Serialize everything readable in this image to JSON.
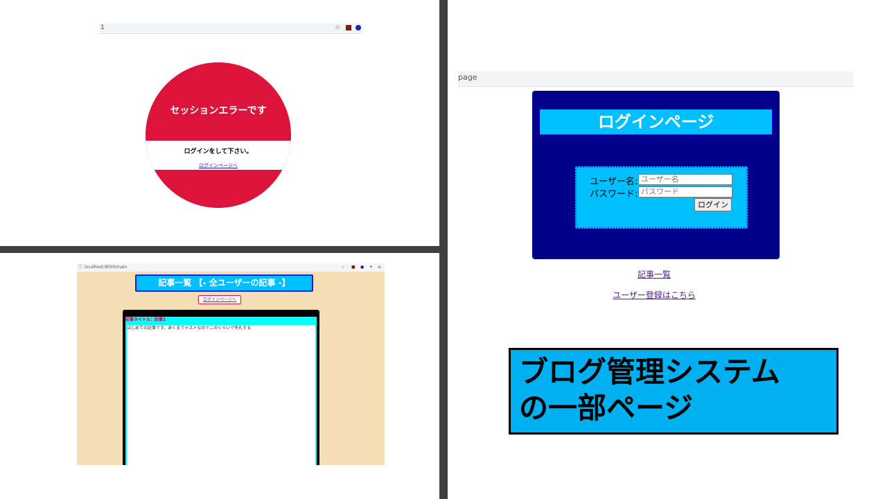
{
  "session_error": {
    "address_text": "1",
    "title": "セッションエラーです",
    "message": "ログインをして下さい。",
    "link": "ログインページへ",
    "colors": {
      "circle": "#dc143c"
    }
  },
  "login_page": {
    "address_text": "page",
    "title": "ログインページ",
    "username_label": "ユーザー名:",
    "username_placeholder": "ユーザー名",
    "password_label": "パスワード:",
    "password_placeholder": "パスワード",
    "login_button": "ログイン",
    "articles_link": "記事一覧",
    "register_link": "ユーザー登録はこちら",
    "colors": {
      "box": "#00008b",
      "accent": "#00bfff"
    }
  },
  "article_list": {
    "address_text": "localhost:8000/main",
    "title": "記事一覧 【- 全ユーザーの記事 -】",
    "login_link": "ログインページへ",
    "article_header": "記事タイトル：記事1",
    "article_body": "はじめての記事です。あくまでテストなのでこのくらいで失礼する",
    "colors": {
      "background": "#f5deb3"
    }
  },
  "caption": {
    "line1": "ブログ管理システム",
    "line2": "の一部ページ"
  }
}
